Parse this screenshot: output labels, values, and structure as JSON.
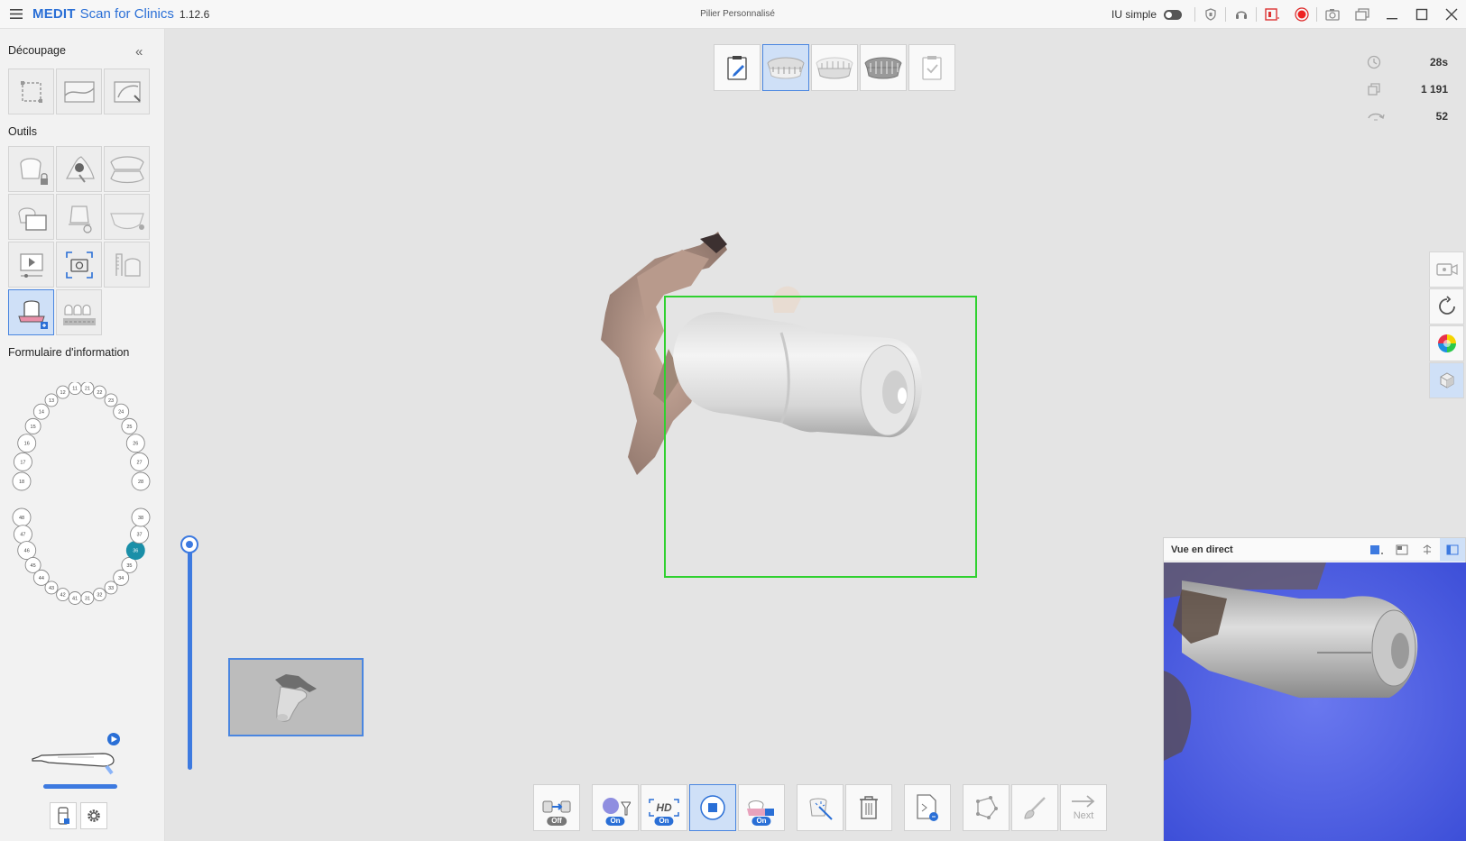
{
  "app": {
    "brand": "MEDIT",
    "brand_rest": "Scan for Clinics",
    "version": "1.12.6",
    "window_title": "Pilier Personnalisé",
    "simple_ui_label": "IU simple"
  },
  "sidebar": {
    "section_cut": "Découpage",
    "section_tools": "Outils",
    "section_form": "Formulaire d'information",
    "cut_tools": [
      "lasso-select-icon",
      "smart-cut-icon",
      "brush-select-icon"
    ],
    "tools": [
      "tooth-lock-icon",
      "color-filter-icon",
      "occlusion-icon",
      "image-overlay-icon",
      "margin-tool-icon",
      "jaw-icon",
      "video-play-icon",
      "camera-capture-icon",
      "ruler-icon",
      "abutment-scan-icon",
      "teeth-library-icon"
    ],
    "selected_tooth": "36"
  },
  "teeth": {
    "upper": [
      "18",
      "17",
      "16",
      "15",
      "14",
      "13",
      "12",
      "11",
      "21",
      "22",
      "23",
      "24",
      "25",
      "26",
      "27",
      "28"
    ],
    "lower": [
      "48",
      "47",
      "46",
      "45",
      "44",
      "43",
      "42",
      "41",
      "31",
      "32",
      "33",
      "34",
      "35",
      "36",
      "37",
      "38"
    ]
  },
  "stats": {
    "time": "28s",
    "frames": "1 191",
    "rotations": "52"
  },
  "stages": [
    "edit-form-icon",
    "upper-jaw-icon",
    "lower-jaw-icon",
    "occlusion-icon",
    "review-check-icon"
  ],
  "live_view": {
    "title": "Vue en direct"
  },
  "bottom": {
    "toggle_off": "Off",
    "toggle_on": "On",
    "hd_label": "HD",
    "next_label": "Next"
  }
}
